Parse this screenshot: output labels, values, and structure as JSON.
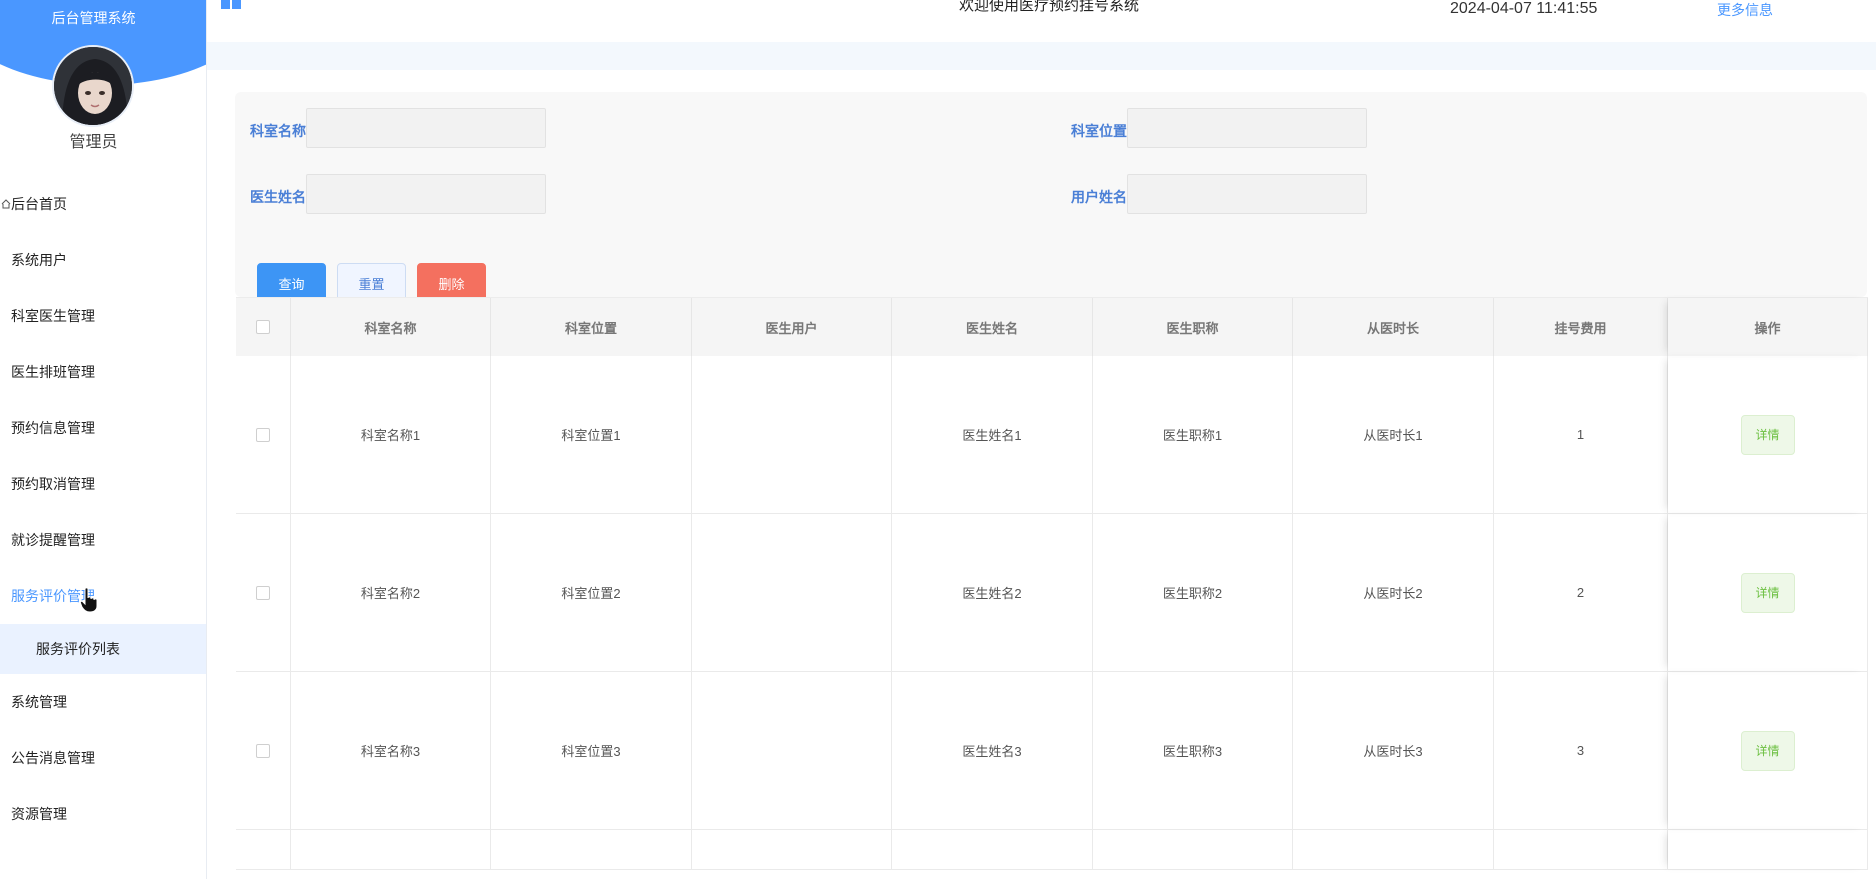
{
  "app": {
    "title": "后台管理系统",
    "role": "管理员"
  },
  "topbar": {
    "welcome": "欢迎使用医疗预约挂号系统",
    "datetime": "2024-04-07 11:41:55",
    "more": "更多信息"
  },
  "menu": {
    "items": [
      {
        "label": "后台首页"
      },
      {
        "label": "系统用户"
      },
      {
        "label": "科室医生管理"
      },
      {
        "label": "医生排班管理"
      },
      {
        "label": "预约信息管理"
      },
      {
        "label": "预约取消管理"
      },
      {
        "label": "就诊提醒管理"
      },
      {
        "label": "服务评价管理"
      },
      {
        "label": "系统管理"
      },
      {
        "label": "公告消息管理"
      },
      {
        "label": "资源管理"
      }
    ],
    "sub_label": "服务评价列表"
  },
  "search": {
    "dept_name_label": "科室名称",
    "dept_location_label": "科室位置",
    "doctor_name_label": "医生姓名",
    "user_name_label": "用户姓名",
    "query_label": "查询",
    "reset_label": "重置",
    "delete_label": "删除"
  },
  "table": {
    "headers": [
      "科室名称",
      "科室位置",
      "医生用户",
      "医生姓名",
      "医生职称",
      "从医时长",
      "挂号费用",
      "操作"
    ],
    "rows": [
      {
        "dept": "科室名称1",
        "loc": "科室位置1",
        "user": "",
        "name": "医生姓名1",
        "title": "医生职称1",
        "years": "从医时长1",
        "fee": "1",
        "action": "详情"
      },
      {
        "dept": "科室名称2",
        "loc": "科室位置2",
        "user": "",
        "name": "医生姓名2",
        "title": "医生职称2",
        "years": "从医时长2",
        "fee": "2",
        "action": "详情"
      },
      {
        "dept": "科室名称3",
        "loc": "科室位置3",
        "user": "",
        "name": "医生姓名3",
        "title": "医生职称3",
        "years": "从医时长3",
        "fee": "3",
        "action": "详情"
      }
    ]
  },
  "colors": {
    "accent": "#4a97ff",
    "delete": "#f4705f",
    "detail_text": "#6bbf3f"
  }
}
